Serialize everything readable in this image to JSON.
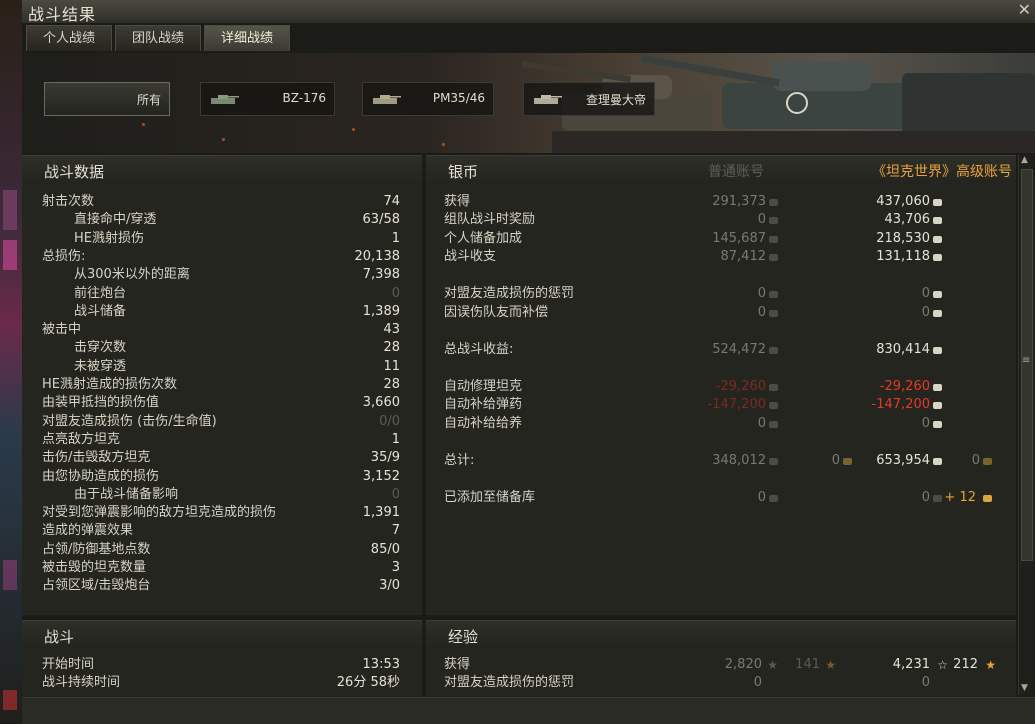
{
  "window": {
    "title": "战斗结果",
    "close_glyph": "✕"
  },
  "tabs": [
    {
      "label": "个人战绩"
    },
    {
      "label": "团队战绩"
    },
    {
      "label": "详细战绩"
    }
  ],
  "vehicles": [
    {
      "label": "所有"
    },
    {
      "label": "BZ-176"
    },
    {
      "label": "PM35/46"
    },
    {
      "label": "查理曼大帝"
    }
  ],
  "combat_data": {
    "header": "战斗数据",
    "rows": [
      {
        "label": "射击次数",
        "value": "74",
        "indent": false
      },
      {
        "label": "直接命中/穿透",
        "value": "63/58",
        "indent": true
      },
      {
        "label": "HE溅射损伤",
        "value": "1",
        "indent": true
      },
      {
        "label": "总损伤:",
        "value": "20,138",
        "indent": false
      },
      {
        "label": "从300米以外的距离",
        "value": "7,398",
        "indent": true
      },
      {
        "label": "前往炮台",
        "value": "0",
        "indent": true,
        "dim": true
      },
      {
        "label": "战斗储备",
        "value": "1,389",
        "indent": true
      },
      {
        "label": "被击中",
        "value": "43",
        "indent": false
      },
      {
        "label": "击穿次数",
        "value": "28",
        "indent": true
      },
      {
        "label": "未被穿透",
        "value": "11",
        "indent": true
      },
      {
        "label": "HE溅射造成的损伤次数",
        "value": "28",
        "indent": false
      },
      {
        "label": "由装甲抵挡的损伤值",
        "value": "3,660",
        "indent": false
      },
      {
        "label": "对盟友造成损伤 (击伤/生命值)",
        "value": "0/0",
        "indent": false,
        "dim": true
      },
      {
        "label": "点亮敌方坦克",
        "value": "1",
        "indent": false
      },
      {
        "label": "击伤/击毁敌方坦克",
        "value": "35/9",
        "indent": false
      },
      {
        "label": "由您协助造成的损伤",
        "value": "3,152",
        "indent": false
      },
      {
        "label": "由于战斗储备影响",
        "value": "0",
        "indent": true,
        "dim": true
      },
      {
        "label": "对受到您弹震影响的敌方坦克造成的损伤",
        "value": "1,391",
        "indent": false
      },
      {
        "label": "造成的弹震效果",
        "value": "7",
        "indent": false
      },
      {
        "label": "占领/防御基地点数",
        "value": "85/0",
        "indent": false
      },
      {
        "label": "被击毁的坦克数量",
        "value": "3",
        "indent": false
      },
      {
        "label": "占领区域/击毁炮台",
        "value": "3/0",
        "indent": false
      }
    ]
  },
  "credits": {
    "header": "银币",
    "col_standard": "普通账号",
    "col_premium": "《坦克世界》高级账号",
    "rows": [
      {
        "label": "获得",
        "std": "291,373",
        "prem": "437,060"
      },
      {
        "label": "组队战斗时奖励",
        "std": "0",
        "prem": "43,706"
      },
      {
        "label": "个人储备加成",
        "std": "145,687",
        "prem": "218,530"
      },
      {
        "label": "战斗收支",
        "std": "87,412",
        "prem": "131,118"
      },
      {
        "label": "对盟友造成损伤的惩罚",
        "std": "0",
        "prem": "0",
        "gap": true
      },
      {
        "label": "因误伤队友而补偿",
        "std": "0",
        "prem": "0"
      },
      {
        "label": "总战斗收益:",
        "std": "524,472",
        "prem": "830,414",
        "gap": true
      },
      {
        "label": "自动修理坦克",
        "std": "-29,260",
        "prem": "-29,260",
        "neg": true,
        "gap": true
      },
      {
        "label": "自动补给弹药",
        "std": "-147,200",
        "prem": "-147,200",
        "neg": true
      },
      {
        "label": "自动补给给养",
        "std": "0",
        "prem": "0"
      },
      {
        "label": "总计:",
        "std": "348,012",
        "std_gold": "0",
        "prem": "653,954",
        "prem_gold": "0",
        "gap": true
      },
      {
        "label": "已添加至储备库",
        "std": "0",
        "std2": "0",
        "prem_gold_add": "+ 12",
        "gap": true
      }
    ]
  },
  "battle": {
    "header": "战斗",
    "rows": [
      {
        "label": "开始时间",
        "value": "13:53"
      },
      {
        "label": "战斗持续时间",
        "value": "26分 58秒"
      }
    ]
  },
  "experience": {
    "header": "经验",
    "rows": [
      {
        "label": "获得",
        "std": "2,820",
        "std_free": "141",
        "prem": "4,231",
        "prem_free": "212"
      },
      {
        "label": "对盟友造成损伤的惩罚",
        "std": "0",
        "prem": "0"
      }
    ]
  },
  "colors": {
    "gold": "#e8a23a",
    "negative": "#e23a2a",
    "panel": "#252520"
  }
}
